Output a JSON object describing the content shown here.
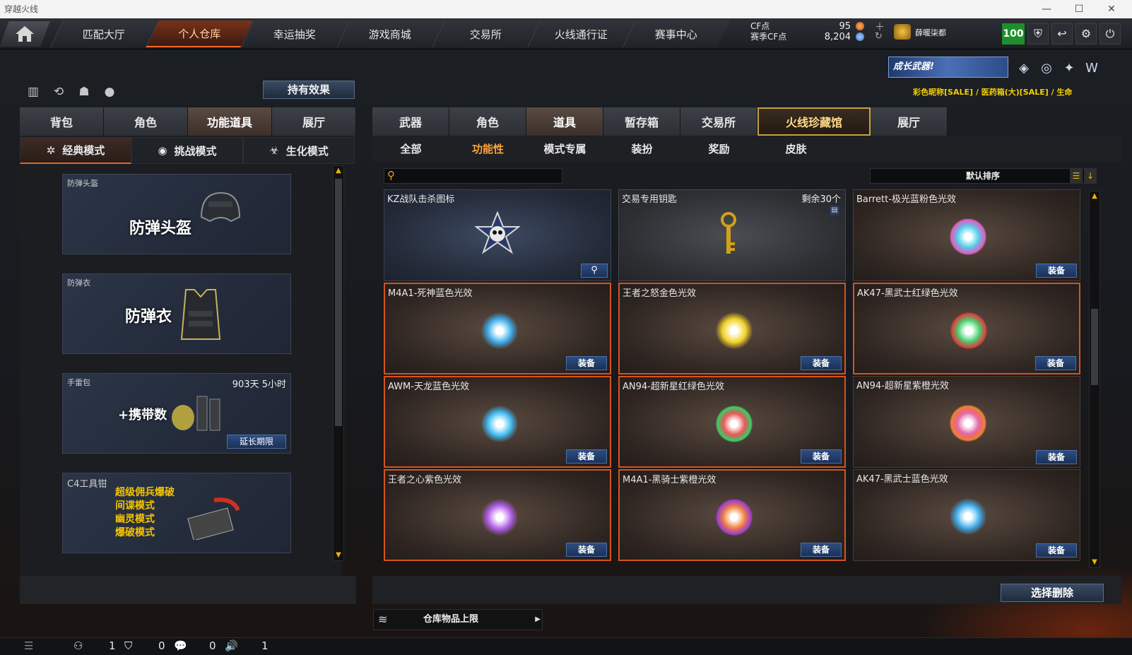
{
  "window": {
    "title": "穿越火线"
  },
  "topnav": {
    "tabs": [
      {
        "label": "匹配大厅"
      },
      {
        "label": "个人仓库"
      },
      {
        "label": "幸运抽奖"
      },
      {
        "label": "游戏商城"
      },
      {
        "label": "交易所"
      },
      {
        "label": "火线通行证"
      },
      {
        "label": "赛事中心"
      }
    ],
    "active_tab": "个人仓库",
    "cf_label": "CF点",
    "season_cf_label": "赛季CF点",
    "cf_value": "95",
    "season_cf_value": "8,204",
    "username": "薛暖柒都",
    "level": "100"
  },
  "left": {
    "effect_button": "持有效果",
    "tabs": [
      "背包",
      "角色",
      "功能道具",
      "展厅"
    ],
    "active_tab": "功能道具",
    "modes": [
      "经典模式",
      "挑战模式",
      "生化模式"
    ],
    "active_mode": "经典模式",
    "items": [
      {
        "name": "防弹头盔",
        "text": "防弹头盔"
      },
      {
        "name": "防弹衣",
        "text": "防弹衣"
      },
      {
        "name": "手雷包",
        "text": "+携带数",
        "time": "903天 5小时",
        "button": "延长期限"
      },
      {
        "name": "C4工具钳",
        "lines": [
          "超级佣兵爆破",
          "间谍模式",
          "幽灵模式",
          "爆破模式"
        ]
      }
    ]
  },
  "right": {
    "banner_text": "成长武器!",
    "marquee": "彩色昵称[SALE] / 医药箱(大)[SALE] / 生命",
    "tabs": [
      "武器",
      "角色",
      "道具",
      "暂存箱",
      "交易所",
      "火线珍藏馆",
      "展厅"
    ],
    "active_tab": "道具",
    "subtabs": [
      "全部",
      "功能性",
      "模式专属",
      "装扮",
      "奖励",
      "皮肤"
    ],
    "active_subtab": "功能性",
    "search_placeholder": "",
    "sort_label": "默认排序",
    "equip_label": "装备",
    "items": [
      {
        "name": "KZ战队击杀图标",
        "color": "#dddddd"
      },
      {
        "name": "交易专用钥匙",
        "remain": "剩余30个",
        "color": "#d4a017"
      },
      {
        "name": "Barrett-极光蓝粉色光效",
        "color": "#49c8e8"
      },
      {
        "name": "M4A1-死神蓝色光效",
        "color": "#3aa8e8"
      },
      {
        "name": "王者之怒金色光效",
        "color": "#f0d020"
      },
      {
        "name": "AK47-黑武士红绿色光效",
        "color": "#3ad06a"
      },
      {
        "name": "AWM-天龙蓝色光效",
        "color": "#3ab8f0"
      },
      {
        "name": "AN94-超新星红绿色光效",
        "color": "#e84848"
      },
      {
        "name": "AN94-超新星紫橙光效",
        "color": "#e05aa0"
      },
      {
        "name": "王者之心紫色光效",
        "color": "#b05ae8"
      },
      {
        "name": "M4A1-黑骑士紫橙光效",
        "color": "#f07a30"
      },
      {
        "name": "AK47-黑武士蓝色光效",
        "color": "#3aa8e8"
      }
    ],
    "delete_button": "选择删除",
    "storage_limit": "仓库物品上限"
  },
  "status": {
    "v1": "1",
    "v2": "0",
    "v3": "0",
    "v4": "1"
  }
}
